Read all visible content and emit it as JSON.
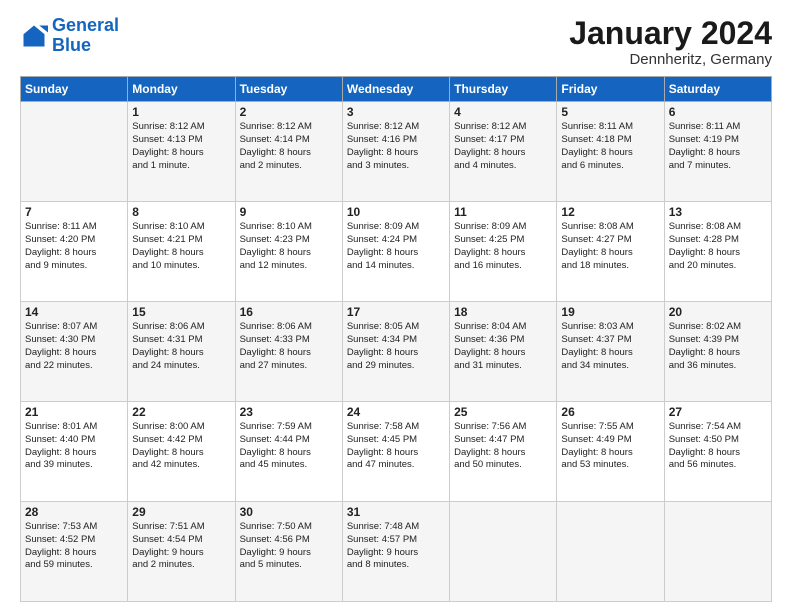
{
  "header": {
    "logo_line1": "General",
    "logo_line2": "Blue",
    "month": "January 2024",
    "location": "Dennheritz, Germany"
  },
  "weekdays": [
    "Sunday",
    "Monday",
    "Tuesday",
    "Wednesday",
    "Thursday",
    "Friday",
    "Saturday"
  ],
  "rows": [
    [
      {
        "day": "",
        "text": ""
      },
      {
        "day": "1",
        "text": "Sunrise: 8:12 AM\nSunset: 4:13 PM\nDaylight: 8 hours\nand 1 minute."
      },
      {
        "day": "2",
        "text": "Sunrise: 8:12 AM\nSunset: 4:14 PM\nDaylight: 8 hours\nand 2 minutes."
      },
      {
        "day": "3",
        "text": "Sunrise: 8:12 AM\nSunset: 4:16 PM\nDaylight: 8 hours\nand 3 minutes."
      },
      {
        "day": "4",
        "text": "Sunrise: 8:12 AM\nSunset: 4:17 PM\nDaylight: 8 hours\nand 4 minutes."
      },
      {
        "day": "5",
        "text": "Sunrise: 8:11 AM\nSunset: 4:18 PM\nDaylight: 8 hours\nand 6 minutes."
      },
      {
        "day": "6",
        "text": "Sunrise: 8:11 AM\nSunset: 4:19 PM\nDaylight: 8 hours\nand 7 minutes."
      }
    ],
    [
      {
        "day": "7",
        "text": "Sunrise: 8:11 AM\nSunset: 4:20 PM\nDaylight: 8 hours\nand 9 minutes."
      },
      {
        "day": "8",
        "text": "Sunrise: 8:10 AM\nSunset: 4:21 PM\nDaylight: 8 hours\nand 10 minutes."
      },
      {
        "day": "9",
        "text": "Sunrise: 8:10 AM\nSunset: 4:23 PM\nDaylight: 8 hours\nand 12 minutes."
      },
      {
        "day": "10",
        "text": "Sunrise: 8:09 AM\nSunset: 4:24 PM\nDaylight: 8 hours\nand 14 minutes."
      },
      {
        "day": "11",
        "text": "Sunrise: 8:09 AM\nSunset: 4:25 PM\nDaylight: 8 hours\nand 16 minutes."
      },
      {
        "day": "12",
        "text": "Sunrise: 8:08 AM\nSunset: 4:27 PM\nDaylight: 8 hours\nand 18 minutes."
      },
      {
        "day": "13",
        "text": "Sunrise: 8:08 AM\nSunset: 4:28 PM\nDaylight: 8 hours\nand 20 minutes."
      }
    ],
    [
      {
        "day": "14",
        "text": "Sunrise: 8:07 AM\nSunset: 4:30 PM\nDaylight: 8 hours\nand 22 minutes."
      },
      {
        "day": "15",
        "text": "Sunrise: 8:06 AM\nSunset: 4:31 PM\nDaylight: 8 hours\nand 24 minutes."
      },
      {
        "day": "16",
        "text": "Sunrise: 8:06 AM\nSunset: 4:33 PM\nDaylight: 8 hours\nand 27 minutes."
      },
      {
        "day": "17",
        "text": "Sunrise: 8:05 AM\nSunset: 4:34 PM\nDaylight: 8 hours\nand 29 minutes."
      },
      {
        "day": "18",
        "text": "Sunrise: 8:04 AM\nSunset: 4:36 PM\nDaylight: 8 hours\nand 31 minutes."
      },
      {
        "day": "19",
        "text": "Sunrise: 8:03 AM\nSunset: 4:37 PM\nDaylight: 8 hours\nand 34 minutes."
      },
      {
        "day": "20",
        "text": "Sunrise: 8:02 AM\nSunset: 4:39 PM\nDaylight: 8 hours\nand 36 minutes."
      }
    ],
    [
      {
        "day": "21",
        "text": "Sunrise: 8:01 AM\nSunset: 4:40 PM\nDaylight: 8 hours\nand 39 minutes."
      },
      {
        "day": "22",
        "text": "Sunrise: 8:00 AM\nSunset: 4:42 PM\nDaylight: 8 hours\nand 42 minutes."
      },
      {
        "day": "23",
        "text": "Sunrise: 7:59 AM\nSunset: 4:44 PM\nDaylight: 8 hours\nand 45 minutes."
      },
      {
        "day": "24",
        "text": "Sunrise: 7:58 AM\nSunset: 4:45 PM\nDaylight: 8 hours\nand 47 minutes."
      },
      {
        "day": "25",
        "text": "Sunrise: 7:56 AM\nSunset: 4:47 PM\nDaylight: 8 hours\nand 50 minutes."
      },
      {
        "day": "26",
        "text": "Sunrise: 7:55 AM\nSunset: 4:49 PM\nDaylight: 8 hours\nand 53 minutes."
      },
      {
        "day": "27",
        "text": "Sunrise: 7:54 AM\nSunset: 4:50 PM\nDaylight: 8 hours\nand 56 minutes."
      }
    ],
    [
      {
        "day": "28",
        "text": "Sunrise: 7:53 AM\nSunset: 4:52 PM\nDaylight: 8 hours\nand 59 minutes."
      },
      {
        "day": "29",
        "text": "Sunrise: 7:51 AM\nSunset: 4:54 PM\nDaylight: 9 hours\nand 2 minutes."
      },
      {
        "day": "30",
        "text": "Sunrise: 7:50 AM\nSunset: 4:56 PM\nDaylight: 9 hours\nand 5 minutes."
      },
      {
        "day": "31",
        "text": "Sunrise: 7:48 AM\nSunset: 4:57 PM\nDaylight: 9 hours\nand 8 minutes."
      },
      {
        "day": "",
        "text": ""
      },
      {
        "day": "",
        "text": ""
      },
      {
        "day": "",
        "text": ""
      }
    ]
  ]
}
